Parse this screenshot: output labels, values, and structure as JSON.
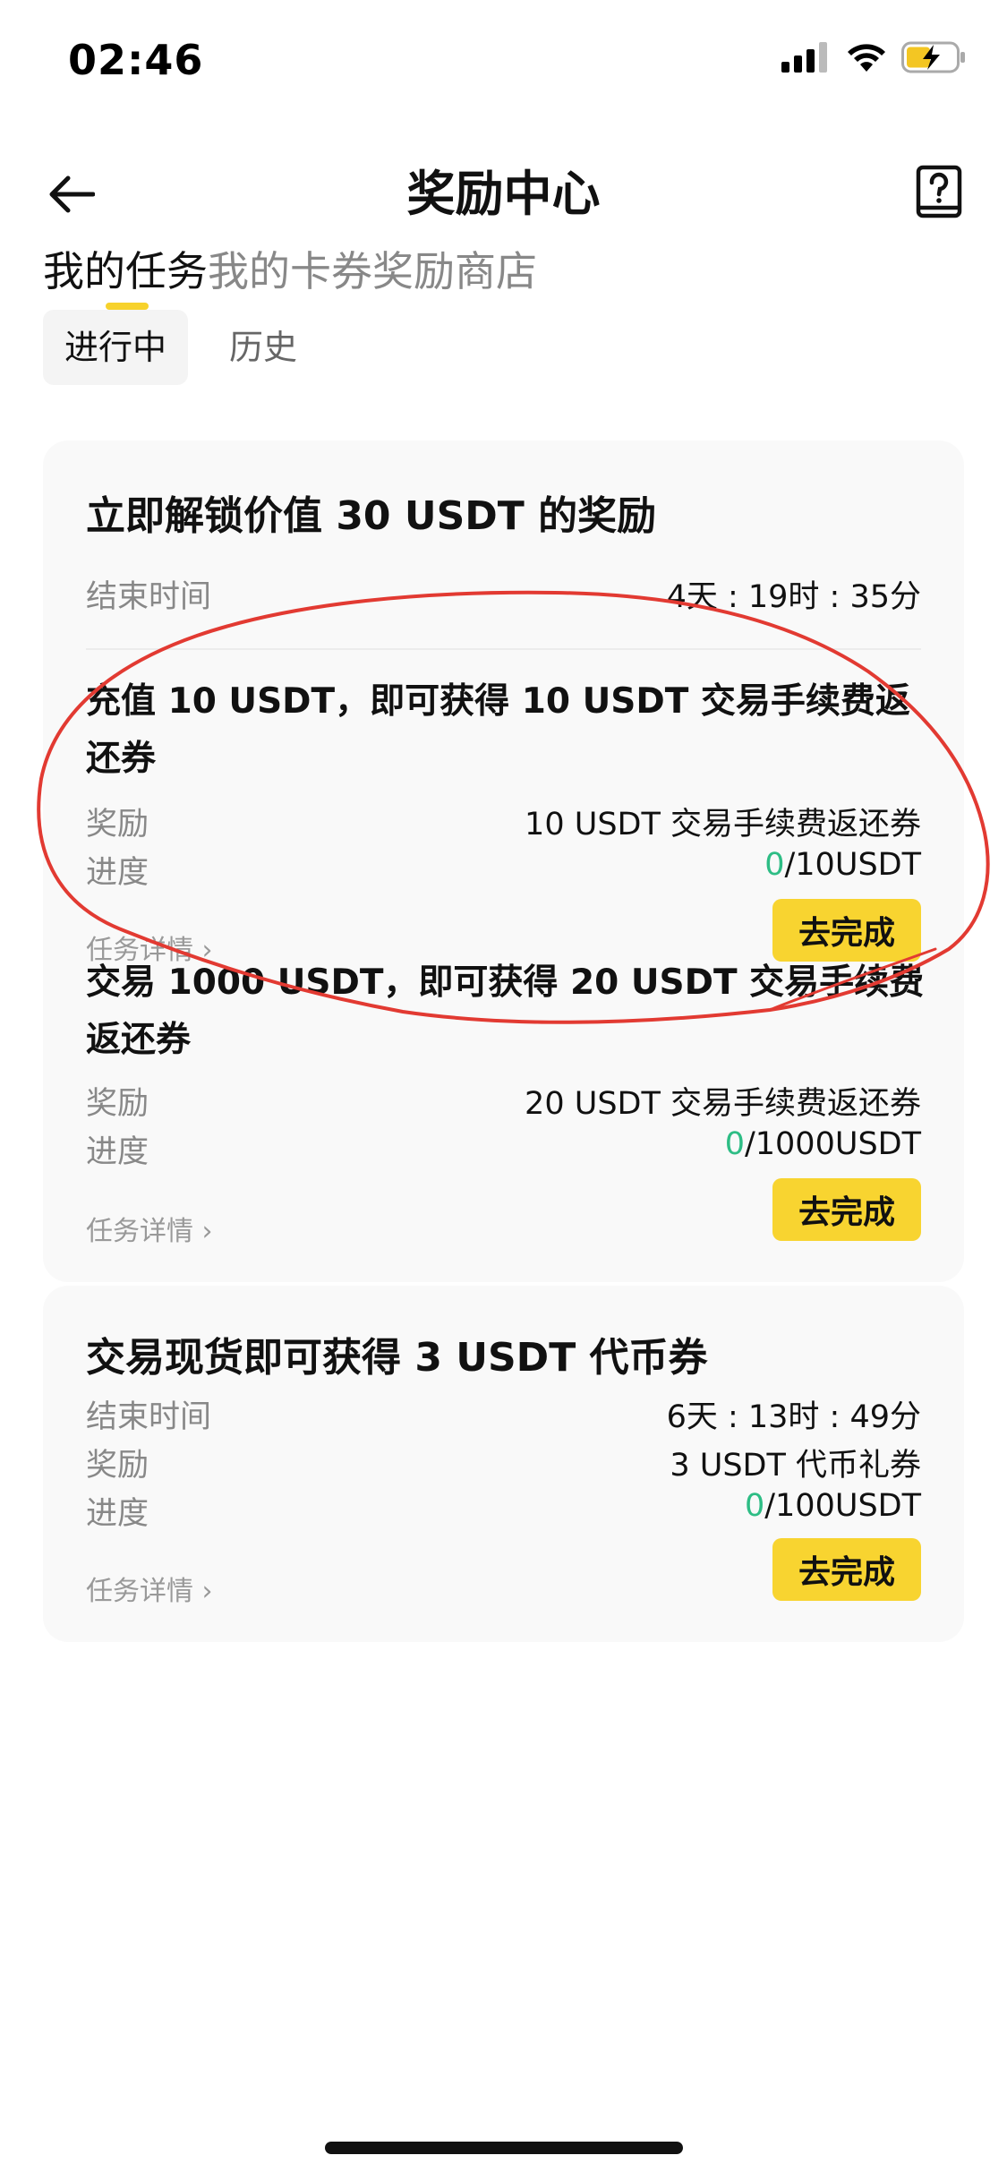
{
  "status_bar": {
    "time": "02:46"
  },
  "header": {
    "title": "奖励中心"
  },
  "top_tabs": [
    {
      "label": "我的任务",
      "active": true
    },
    {
      "label": "我的卡券",
      "active": false
    },
    {
      "label": "奖励商店",
      "active": false
    }
  ],
  "sub_tabs": [
    {
      "label": "进行中",
      "active": true
    },
    {
      "label": "历史",
      "active": false
    }
  ],
  "card1": {
    "title": "立即解锁价值 30 USDT 的奖励",
    "end_time_label": "结束时间",
    "end_time_value": "4天 : 19时 : 35分",
    "tasks": [
      {
        "title": "充值 10 USDT，即可获得 10 USDT 交易手续费返还券",
        "reward_label": "奖励",
        "reward_value": "10 USDT 交易手续费返还券",
        "progress_label": "进度",
        "progress_current": "0",
        "progress_target": "/10USDT",
        "detail_label": "任务详情 ›",
        "action_label": "去完成"
      },
      {
        "title": "交易 1000 USDT，即可获得 20 USDT 交易手续费返还券",
        "reward_label": "奖励",
        "reward_value": "20 USDT 交易手续费返还券",
        "progress_label": "进度",
        "progress_current": "0",
        "progress_target": "/1000USDT",
        "detail_label": "任务详情 ›",
        "action_label": "去完成"
      }
    ]
  },
  "card2": {
    "title": "交易现货即可获得 3 USDT 代币券",
    "end_time_label": "结束时间",
    "end_time_value": "6天 : 13时 : 49分",
    "reward_label": "奖励",
    "reward_value": "3 USDT 代币礼券",
    "progress_label": "进度",
    "progress_current": "0",
    "progress_target": "/100USDT",
    "detail_label": "任务详情 ›",
    "action_label": "去完成"
  },
  "colors": {
    "accent": "#f8d430",
    "progress_green": "#2ebd85",
    "annotation_red": "#e23a32"
  }
}
